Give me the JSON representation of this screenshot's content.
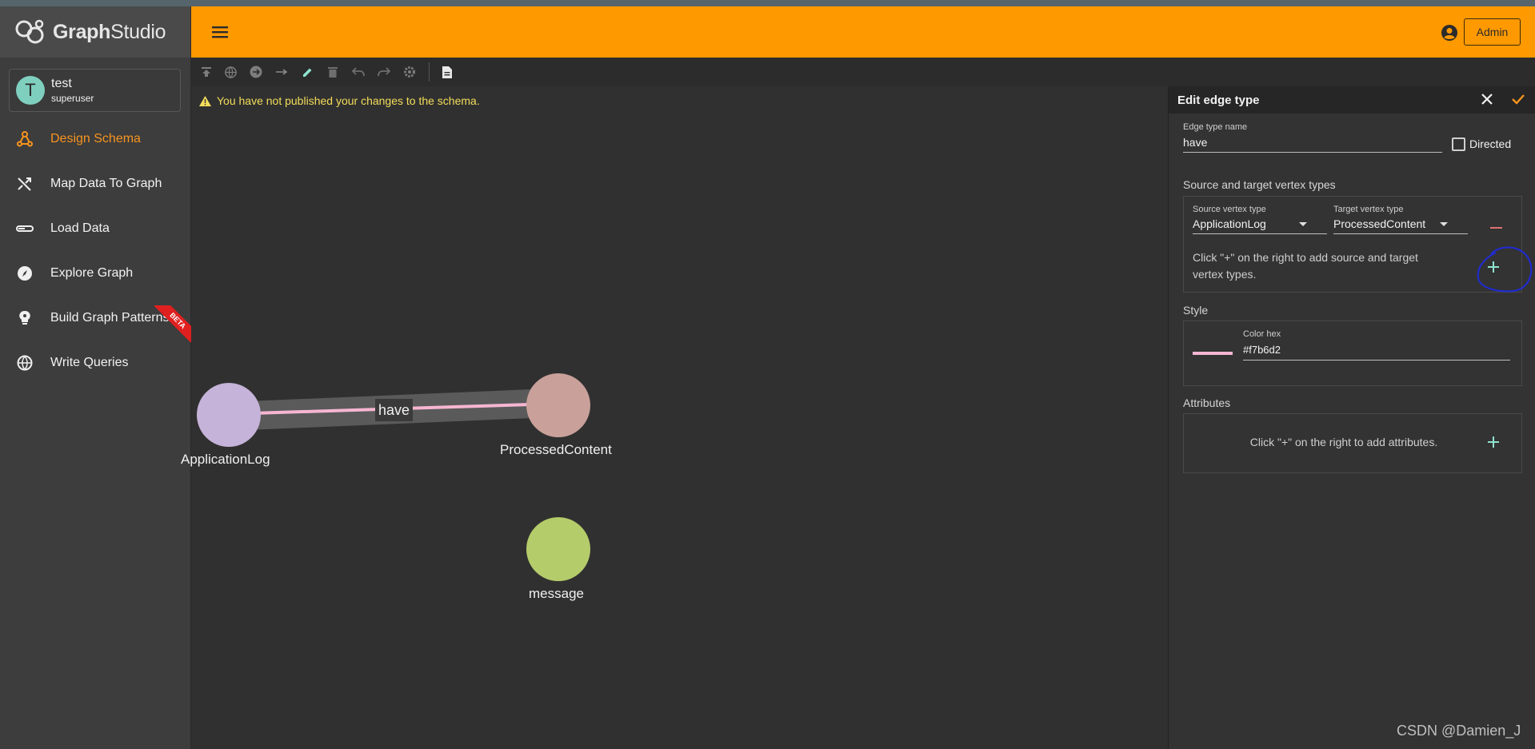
{
  "app": {
    "logo_prefix": "Graph",
    "logo_suffix": "Studio"
  },
  "user": {
    "initial": "T",
    "name": "test",
    "role": "superuser"
  },
  "header": {
    "admin_label": "Admin"
  },
  "nav": [
    {
      "label": "Design Schema",
      "icon": "schema-icon",
      "active": true
    },
    {
      "label": "Map Data To Graph",
      "icon": "shuffle-icon",
      "active": false
    },
    {
      "label": "Load Data",
      "icon": "load-icon",
      "active": false
    },
    {
      "label": "Explore Graph",
      "icon": "compass-icon",
      "active": false
    },
    {
      "label": "Build Graph Patterns",
      "icon": "bulb-icon",
      "active": false,
      "badge": "BETA"
    },
    {
      "label": "Write Queries",
      "icon": "globe-icon",
      "active": false
    }
  ],
  "toolbar": {
    "icons": [
      "publish-icon",
      "global-icon",
      "add-vertex-icon",
      "add-edge-icon",
      "edit-icon",
      "delete-icon",
      "undo-icon",
      "redo-icon",
      "settings-icon",
      "document-icon"
    ]
  },
  "canvas": {
    "warning": "You have not published your changes to the schema.",
    "edge_label": "have",
    "vertices": [
      {
        "label": "ApplicationLog",
        "color": "#c5b3d9"
      },
      {
        "label": "ProcessedContent",
        "color": "#c9a09a"
      },
      {
        "label": "message",
        "color": "#b5cc6a"
      }
    ],
    "edge_color": "#f7b6d2"
  },
  "panel": {
    "title": "Edge type name",
    "header_title": "Edit edge type",
    "edge_name": "have",
    "directed_label": "Directed",
    "section_vertex_types": "Source and target vertex types",
    "source_label": "Source vertex type",
    "source_value": "ApplicationLog",
    "target_label": "Target vertex type",
    "target_value": "ProcessedContent",
    "add_pair_hint": "Click \"+\" on the right to add source and target vertex types.",
    "section_style": "Style",
    "color_label": "Color hex",
    "color_value": "#f7b6d2",
    "color_text": "#f7b6d2",
    "section_attributes": "Attributes",
    "add_attr_hint": "Click \"+\" on the right to add attributes."
  },
  "watermark": "CSDN @Damien_J"
}
